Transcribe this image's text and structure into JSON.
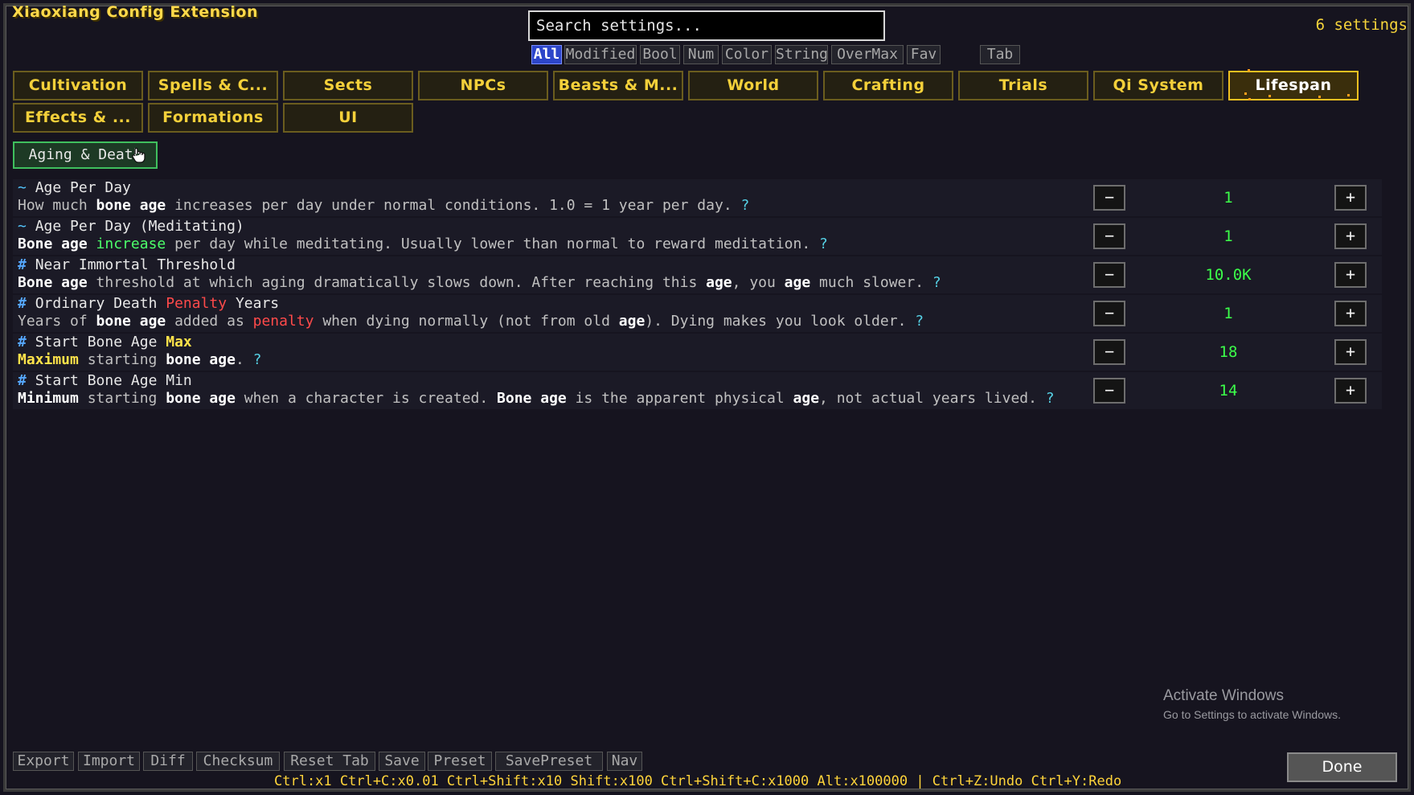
{
  "app": {
    "title": "Xiaoxiang Config Extension",
    "count": "6 settings"
  },
  "search": {
    "placeholder": "Search settings..."
  },
  "filters": [
    "All",
    "Modified",
    "Bool",
    "Num",
    "Color",
    "String",
    "OverMax",
    "Fav",
    "Tab"
  ],
  "active_filter": "All",
  "tabs": [
    "Cultivation",
    "Spells & C...",
    "Sects",
    "NPCs",
    "Beasts & M...",
    "World",
    "Crafting",
    "Trials",
    "Qi System",
    "Lifespan",
    "Effects & ...",
    "Formations",
    "UI"
  ],
  "active_tab": "Lifespan",
  "subcategory": "Aging & Death",
  "settings": [
    {
      "marker": "~",
      "name": [
        {
          "t": "Age Per Day"
        }
      ],
      "desc": [
        {
          "t": "How much "
        },
        {
          "t": "bone age",
          "s": "b"
        },
        {
          "t": " increases per day under normal conditions. 1.0 = 1 year per day. "
        },
        {
          "t": "?",
          "s": "q"
        }
      ],
      "value": "1",
      "minus": "−",
      "plus": "+"
    },
    {
      "marker": "~",
      "name": [
        {
          "t": "Age Per Day (Meditating)"
        }
      ],
      "desc": [
        {
          "t": "Bone age",
          "s": "b"
        },
        {
          "t": " "
        },
        {
          "t": "increase",
          "s": "g"
        },
        {
          "t": " per day while meditating. Usually lower than normal to reward meditation. "
        },
        {
          "t": "?",
          "s": "q"
        }
      ],
      "value": "1",
      "minus": "−",
      "plus": "+"
    },
    {
      "marker": "#",
      "name": [
        {
          "t": "Near Immortal Threshold"
        }
      ],
      "desc": [
        {
          "t": "Bone age",
          "s": "b"
        },
        {
          "t": " threshold at which aging dramatically slows down. After reaching this "
        },
        {
          "t": "age",
          "s": "b"
        },
        {
          "t": ", you "
        },
        {
          "t": "age",
          "s": "b"
        },
        {
          "t": " much slower. "
        },
        {
          "t": "?",
          "s": "q"
        }
      ],
      "value": "10.0K",
      "minus": "−",
      "plus": "+"
    },
    {
      "marker": "#",
      "name": [
        {
          "t": "Ordinary Death "
        },
        {
          "t": "Penalty",
          "s": "r"
        },
        {
          "t": " Years"
        }
      ],
      "desc": [
        {
          "t": "Years of "
        },
        {
          "t": "bone age",
          "s": "b"
        },
        {
          "t": " added as "
        },
        {
          "t": "penalty",
          "s": "r"
        },
        {
          "t": " when dying normally (not from old "
        },
        {
          "t": "age",
          "s": "b"
        },
        {
          "t": "). Dying makes you look older. "
        },
        {
          "t": "?",
          "s": "q"
        }
      ],
      "value": "1",
      "minus": "−",
      "plus": "+"
    },
    {
      "marker": "#",
      "name": [
        {
          "t": "Start Bone Age "
        },
        {
          "t": "Max",
          "s": "y"
        }
      ],
      "desc": [
        {
          "t": "Maximum",
          "s": "y"
        },
        {
          "t": " starting "
        },
        {
          "t": "bone age",
          "s": "b"
        },
        {
          "t": ". "
        },
        {
          "t": "?",
          "s": "q"
        }
      ],
      "value": "18",
      "minus": "−",
      "plus": "+"
    },
    {
      "marker": "#",
      "name": [
        {
          "t": "Start Bone Age Min"
        }
      ],
      "desc": [
        {
          "t": "Minimum",
          "s": "b"
        },
        {
          "t": " starting "
        },
        {
          "t": "bone age",
          "s": "b"
        },
        {
          "t": " when a character is created. "
        },
        {
          "t": "Bone age",
          "s": "b"
        },
        {
          "t": " is the apparent physical "
        },
        {
          "t": "age",
          "s": "b"
        },
        {
          "t": ", not actual years lived. "
        },
        {
          "t": "?",
          "s": "q"
        }
      ],
      "value": "14",
      "minus": "−",
      "plus": "+"
    }
  ],
  "footer_buttons": [
    "Export",
    "Import",
    "Diff",
    "Checksum",
    "Reset Tab",
    "Save",
    "Preset",
    "SavePreset",
    "Nav"
  ],
  "hotkeys": "Ctrl:x1  Ctrl+C:x0.01  Ctrl+Shift:x10  Shift:x100  Ctrl+Shift+C:x1000  Alt:x100000  |  Ctrl+Z:Undo  Ctrl+Y:Redo",
  "done_label": "Done",
  "watermark": {
    "line1": "Activate Windows",
    "line2": "Go to Settings to activate Windows."
  },
  "colors": {
    "accent_gold": "#f4d03a",
    "active_filter": "#2c45c9",
    "value_green": "#3cff4a",
    "subtab_green": "#3fbf5e"
  }
}
